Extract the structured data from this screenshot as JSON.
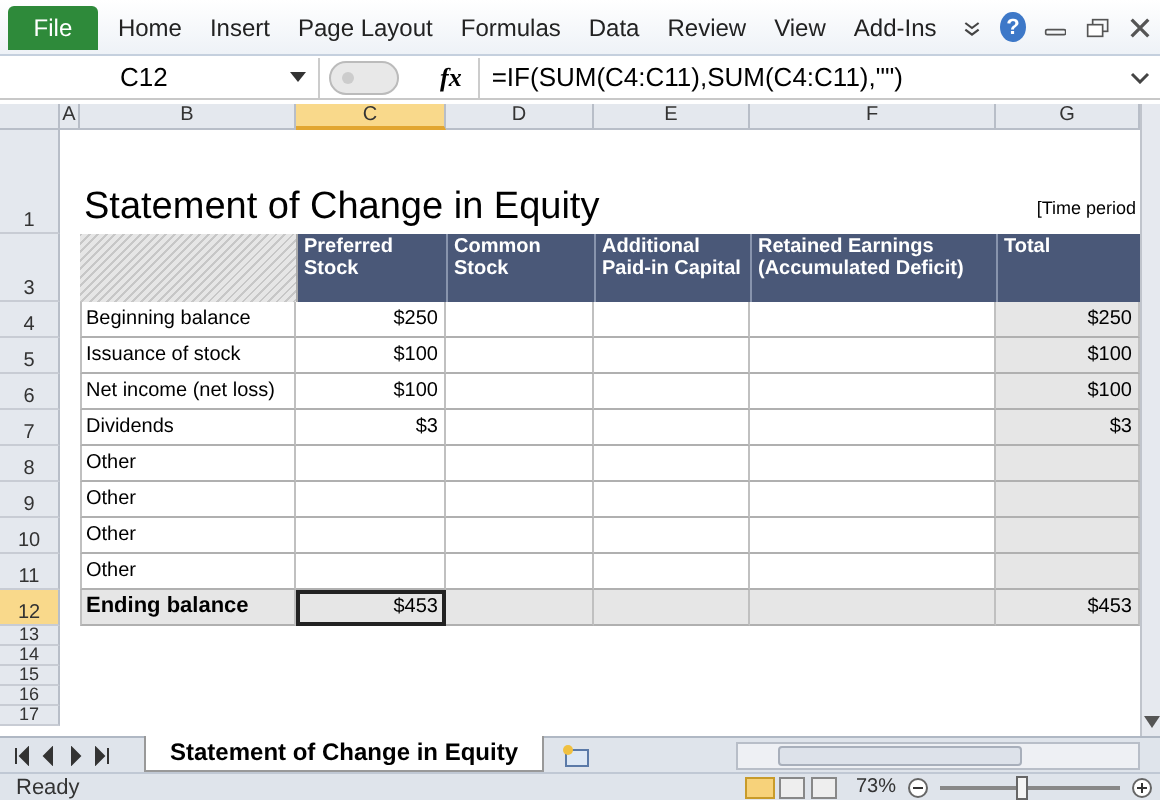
{
  "ribbon": {
    "file_tab": "File",
    "tabs": [
      "Home",
      "Insert",
      "Page Layout",
      "Formulas",
      "Data",
      "Review",
      "View",
      "Add-Ins"
    ],
    "help": "?"
  },
  "formula_bar": {
    "name_box": "C12",
    "function_label": "fx",
    "formula": "=IF(SUM(C4:C11),SUM(C4:C11),\"\")"
  },
  "columns": [
    {
      "label": "A",
      "selected": false
    },
    {
      "label": "B",
      "selected": false
    },
    {
      "label": "C",
      "selected": true
    },
    {
      "label": "D",
      "selected": false
    },
    {
      "label": "E",
      "selected": false
    },
    {
      "label": "F",
      "selected": false
    },
    {
      "label": "G",
      "selected": false
    }
  ],
  "sheet": {
    "title_row": "1",
    "title": "Statement of Change in Equity",
    "period": "[Time period",
    "header_row": {
      "row": "3",
      "headings": [
        "Preferred Stock",
        "Common Stock",
        "Additional Paid-in Capital",
        "Retained Earnings (Accumulated Deficit)",
        "Total"
      ]
    },
    "rows": [
      {
        "row": "4",
        "label": "Beginning balance",
        "kind": "item",
        "selected": false,
        "preferred_stock": "$250",
        "total": "$250"
      },
      {
        "row": "5",
        "label": "Issuance of stock",
        "kind": "item",
        "selected": false,
        "preferred_stock": "$100",
        "total": "$100"
      },
      {
        "row": "6",
        "label": "Net income (net loss)",
        "kind": "item",
        "selected": false,
        "preferred_stock": "$100",
        "total": "$100"
      },
      {
        "row": "7",
        "label": "Dividends",
        "kind": "item",
        "selected": false,
        "preferred_stock": "$3",
        "total": "$3"
      },
      {
        "row": "8",
        "label": "Other",
        "kind": "item",
        "selected": false
      },
      {
        "row": "9",
        "label": "Other",
        "kind": "item",
        "selected": false
      },
      {
        "row": "10",
        "label": "Other",
        "kind": "item",
        "selected": false
      },
      {
        "row": "11",
        "label": "Other",
        "kind": "item",
        "selected": false
      },
      {
        "row": "12",
        "label": "Ending balance",
        "kind": "total",
        "selected": true,
        "preferred_stock": "$453",
        "total": "$453"
      }
    ],
    "blank_rows": [
      "13",
      "14",
      "15",
      "16",
      "17"
    ]
  },
  "sheet_tabs": [
    {
      "label": "Statement of Change in Equity",
      "selected": true
    }
  ],
  "status_bar": {
    "status": "Ready",
    "zoom": "73%",
    "zoom_slider": {
      "level": 0.45
    }
  }
}
